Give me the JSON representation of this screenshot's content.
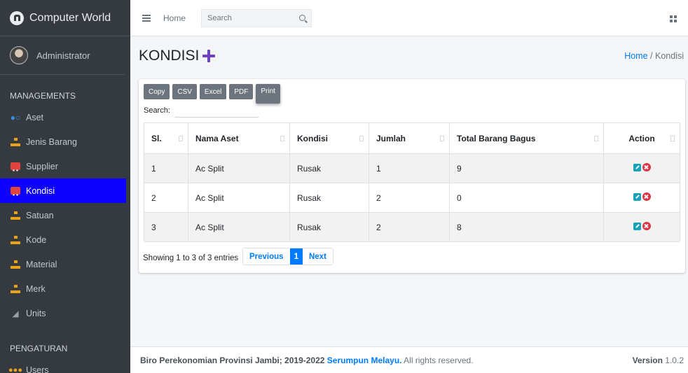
{
  "brand": {
    "name": "Computer World"
  },
  "user": {
    "name": "Administrator"
  },
  "sidebar": {
    "header_1": "MANAGEMENTS",
    "header_2": "PENGATURAN",
    "items": [
      {
        "label": "Aset",
        "icon": "users-icon"
      },
      {
        "label": "Jenis Barang",
        "icon": "sitemap-icon"
      },
      {
        "label": "Supplier",
        "icon": "truck-icon"
      },
      {
        "label": "Kondisi",
        "icon": "truck-icon",
        "active": true
      },
      {
        "label": "Satuan",
        "icon": "sitemap-icon"
      },
      {
        "label": "Kode",
        "icon": "sitemap-icon"
      },
      {
        "label": "Material",
        "icon": "sitemap-icon"
      },
      {
        "label": "Merk",
        "icon": "sitemap-icon"
      },
      {
        "label": "Units",
        "icon": "ruler-icon"
      }
    ],
    "users_label": "Users",
    "active_color": "#0d00ff"
  },
  "topbar": {
    "home": "Home",
    "search_placeholder": "Search"
  },
  "page": {
    "title": "KONDISI",
    "breadcrumb_home": "Home",
    "breadcrumb_sep": "/",
    "breadcrumb_current": "Kondisi"
  },
  "table_tools": {
    "buttons": [
      "Copy",
      "CSV",
      "Excel",
      "PDF",
      "Print"
    ],
    "search_label": "Search:"
  },
  "table": {
    "columns": [
      "Sl.",
      "Nama Aset",
      "Kondisi",
      "Jumlah",
      "Total Barang Bagus",
      "Action"
    ],
    "rows": [
      [
        "1",
        "Ac Split",
        "Rusak",
        "1",
        "9"
      ],
      [
        "2",
        "Ac Split",
        "Rusak",
        "2",
        "0"
      ],
      [
        "3",
        "Ac Split",
        "Rusak",
        "2",
        "8"
      ]
    ]
  },
  "pagination": {
    "info": "Showing 1 to 3 of 3 entries",
    "previous": "Previous",
    "current": "1",
    "next": "Next"
  },
  "footer": {
    "copyright": "Biro Perekonomian Provinsi Jambi; 2019-2022",
    "link": "Serumpun Melayu.",
    "rights": "All rights reserved.",
    "version_label": "Version",
    "version": "1.0.2"
  }
}
